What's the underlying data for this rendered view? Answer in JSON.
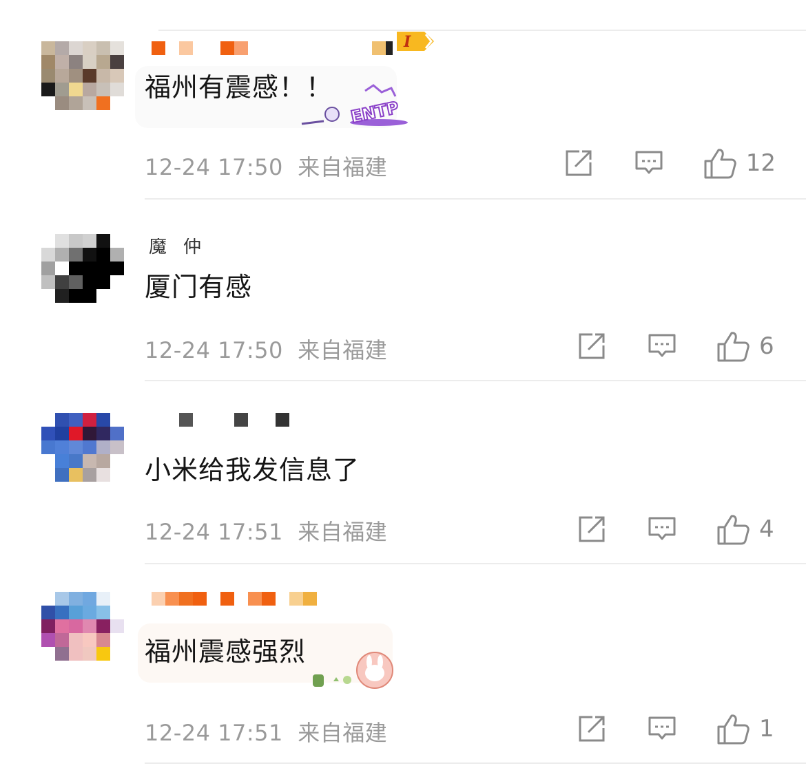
{
  "comments": [
    {
      "text": "福州有震感！！",
      "time": "12-24 17:50",
      "location": "来自福建",
      "likes": "12",
      "level_badge": "I",
      "decoration_text": "ENTP"
    },
    {
      "text": "厦门有感",
      "time": "12-24 17:50",
      "location": "来自福建",
      "likes": "6",
      "username_visible": "魔仲"
    },
    {
      "text": "小米给我发信息了",
      "time": "12-24 17:51",
      "location": "来自福建",
      "likes": "4"
    },
    {
      "text": "福州震感强烈",
      "time": "12-24 17:51",
      "location": "来自福建",
      "likes": "1"
    }
  ],
  "icons": {
    "share": "share-icon",
    "reply": "comment-icon",
    "like": "thumbs-up-icon"
  },
  "colors": {
    "meta_gray": "#9a9a9a",
    "divider": "#ececec",
    "vip_orange": "#f07020"
  }
}
